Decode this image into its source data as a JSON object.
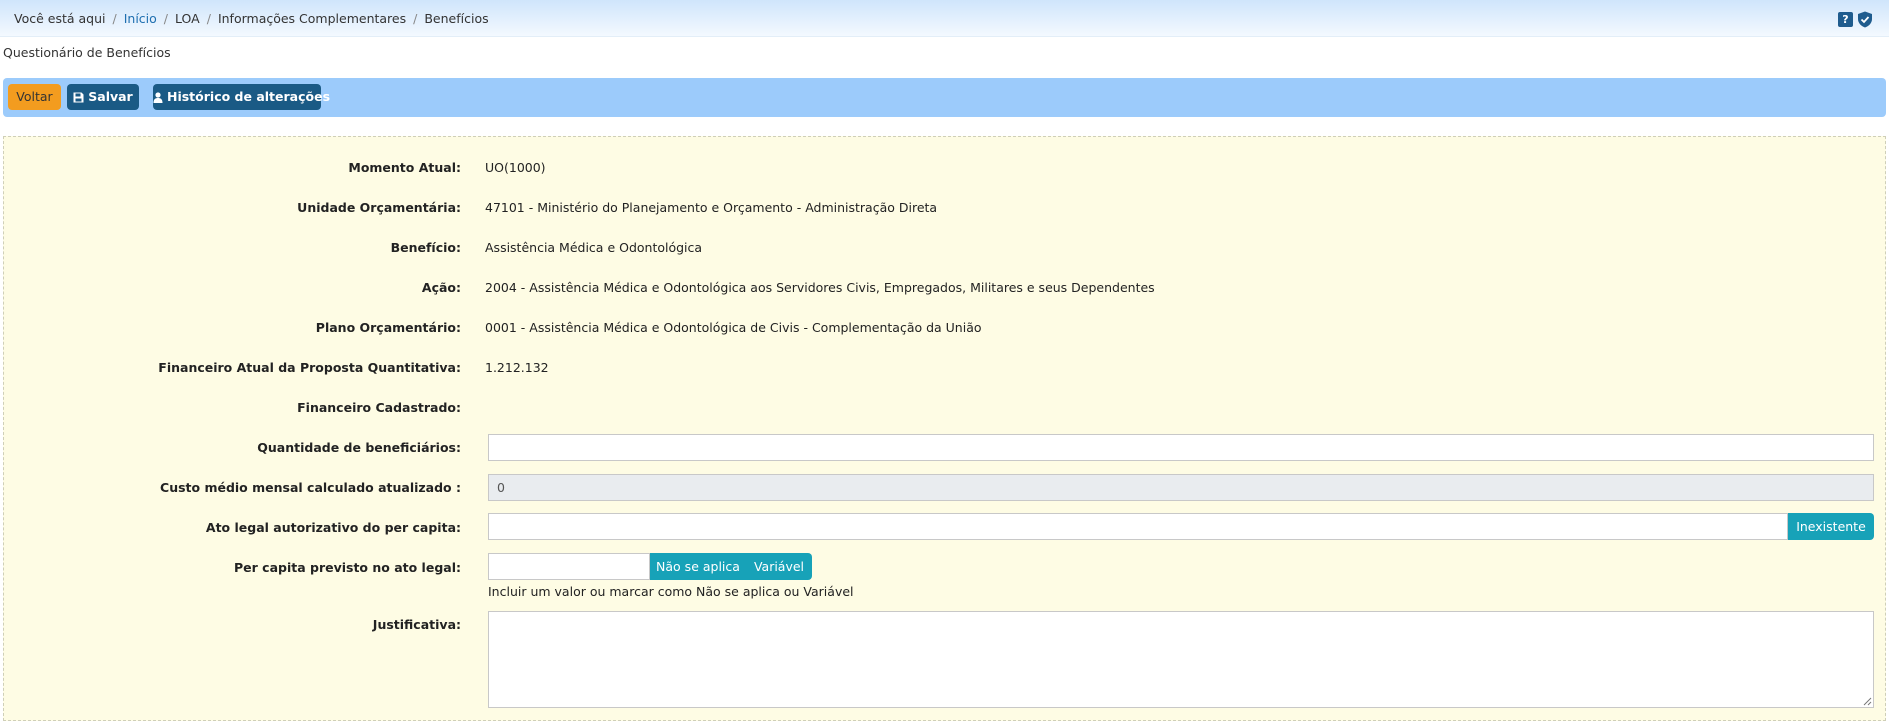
{
  "breadcrumb": {
    "prefix": "Você está aqui",
    "items": [
      "Início",
      "LOA",
      "Informações Complementares",
      "Benefícios"
    ]
  },
  "header_icons": {
    "help": "?",
    "help_icon": "question-icon",
    "security_icon": "shield-check-icon"
  },
  "page_title": "Questionário de Benefícios",
  "toolbar": {
    "back_label": "Voltar",
    "save_label": "Salvar",
    "history_label": "Histórico de alterações"
  },
  "form": {
    "momento_label": "Momento Atual:",
    "momento_value": "UO(1000)",
    "unidade_label": "Unidade Orçamentária:",
    "unidade_value": "47101 - Ministério do Planejamento e Orçamento - Administração Direta",
    "beneficio_label": "Benefício:",
    "beneficio_value": "Assistência Médica e Odontológica",
    "acao_label": "Ação:",
    "acao_value": "2004 - Assistência Médica e Odontológica aos Servidores Civis, Empregados, Militares e seus Dependentes",
    "plano_label": "Plano Orçamentário:",
    "plano_value": "0001 - Assistência Médica e Odontológica de Civis - Complementação da União",
    "financeiro_atual_label": "Financeiro Atual da Proposta Quantitativa:",
    "financeiro_atual_value": "1.212.132",
    "financeiro_cadastrado_label": "Financeiro Cadastrado:",
    "financeiro_cadastrado_value": "",
    "quantidade_label": "Quantidade de beneficiários:",
    "quantidade_value": "",
    "custo_label": "Custo médio mensal calculado atualizado :",
    "custo_value": "0",
    "ato_label": "Ato legal autorizativo do per capita:",
    "ato_value": "",
    "ato_button": "Inexistente",
    "percapita_label": "Per capita previsto no ato legal:",
    "percapita_value": "",
    "percapita_nao_aplica": "Não se aplica",
    "percapita_variavel": "Variável",
    "percapita_hint": "Incluir um valor ou marcar como Não se aplica ou Variável",
    "justificativa_label": "Justificativa:",
    "justificativa_value": ""
  },
  "colors": {
    "toolbar_bg": "#9ccbfb",
    "panel_bg": "#fefce4",
    "back_button": "#f39c1f",
    "primary_button": "#1a5a85",
    "addon_button": "#17a2b8"
  }
}
